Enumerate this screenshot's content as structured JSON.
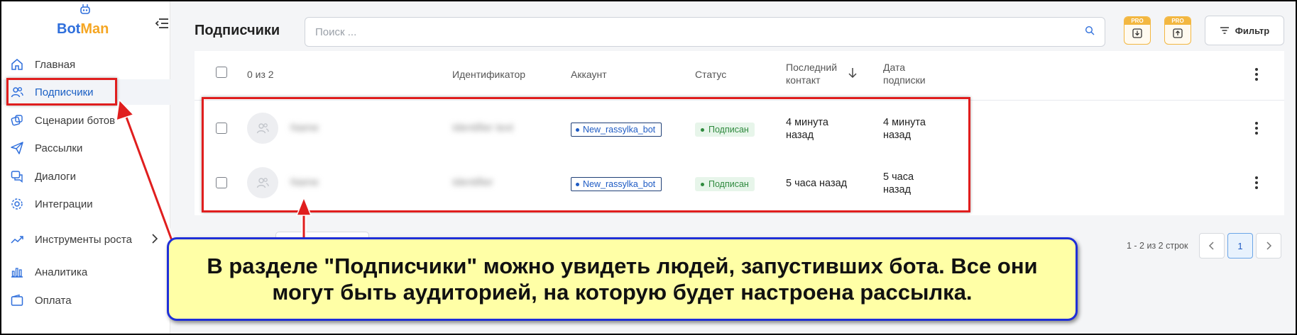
{
  "app": {
    "logo_bot": "Bot",
    "logo_man": "Man"
  },
  "sidebar": {
    "items": [
      {
        "label": "Главная",
        "icon": "home-icon"
      },
      {
        "label": "Подписчики",
        "icon": "users-icon",
        "active": true
      },
      {
        "label": "Сценарии ботов",
        "icon": "scenario-icon"
      },
      {
        "label": "Рассылки",
        "icon": "send-icon"
      },
      {
        "label": "Диалоги",
        "icon": "chat-icon"
      },
      {
        "label": "Интеграции",
        "icon": "integration-icon"
      },
      {
        "label": "Инструменты роста",
        "icon": "growth-icon"
      },
      {
        "label": "Аналитика",
        "icon": "analytics-icon"
      },
      {
        "label": "Оплата",
        "icon": "wallet-icon"
      }
    ]
  },
  "header": {
    "title": "Подписчики",
    "search_placeholder": "Поиск ...",
    "pro_label": "PRO",
    "filter_label": "Фильтр"
  },
  "table": {
    "selection": "0 из 2",
    "columns": {
      "id": "Идентификатор",
      "account": "Аккаунт",
      "status": "Статус",
      "last_contact": "Последний контакт",
      "subscribed": "Дата подписки"
    },
    "rows": [
      {
        "name": "Name",
        "identifier": "Identifier text",
        "account": "New_rassylka_bot",
        "status": "Подписан",
        "last_contact": "4 минута назад",
        "subscribed": "4 минута назад"
      },
      {
        "name": "Name",
        "identifier": "Identifier",
        "account": "New_rassylka_bot",
        "status": "Подписан",
        "last_contact": "5 часа назад",
        "subscribed": "5 часа назад"
      }
    ]
  },
  "pagination": {
    "info": "1 - 2 из 2 строк",
    "current_page": "1"
  },
  "callout": {
    "text": "В разделе \"Подписчики\" можно увидеть людей, запустивших бота. Все они могут быть аудиторией, на которую будет настроена рассылка."
  },
  "colors": {
    "accent": "#2f6fdc",
    "logo_secondary": "#f5a623",
    "annotation_red": "#e01e1e",
    "callout_bg": "#ffffa6",
    "callout_border": "#1f2fd8"
  }
}
